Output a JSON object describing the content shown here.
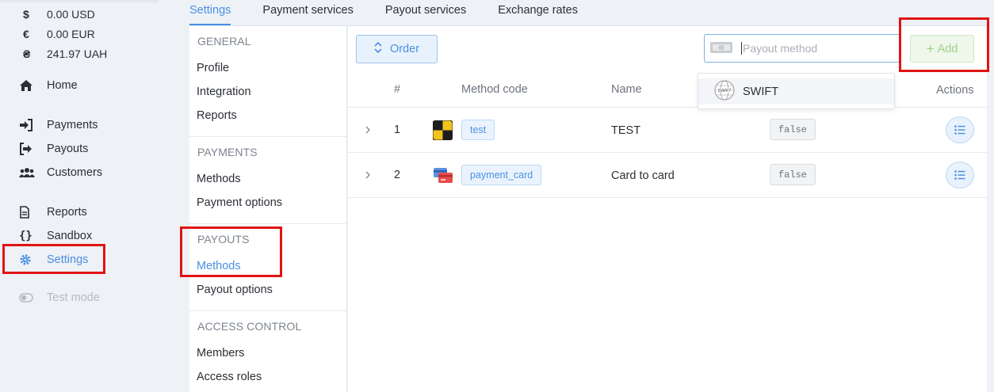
{
  "balances": [
    {
      "symbol": "$",
      "amount": "0.00 USD"
    },
    {
      "symbol": "€",
      "amount": "0.00 EUR"
    },
    {
      "symbol": "₴",
      "amount": "241.97 UAH"
    }
  ],
  "nav": {
    "home": "Home",
    "payments": "Payments",
    "payouts": "Payouts",
    "customers": "Customers",
    "reports": "Reports",
    "sandbox": "Sandbox",
    "settings": "Settings",
    "test_mode": "Test mode"
  },
  "tabs": [
    "Settings",
    "Payment services",
    "Payout services",
    "Exchange rates"
  ],
  "submenu": {
    "general": {
      "heading": "GENERAL",
      "items": [
        "Profile",
        "Integration",
        "Reports"
      ]
    },
    "payments": {
      "heading": "PAYMENTS",
      "items": [
        "Methods",
        "Payment options"
      ]
    },
    "payouts": {
      "heading": "PAYOUTS",
      "items": [
        "Methods",
        "Payout options"
      ]
    },
    "access": {
      "heading": "ACCESS CONTROL",
      "items": [
        "Members",
        "Access roles"
      ]
    }
  },
  "toolbar": {
    "order_label": "Order",
    "search_placeholder": "Payout method",
    "add_label": "Add"
  },
  "table": {
    "headers": {
      "index": "#",
      "method_code": "Method code",
      "name": "Name",
      "actions": "Actions"
    },
    "rows": [
      {
        "index": "1",
        "code": "test",
        "name": "TEST",
        "flag": "false"
      },
      {
        "index": "2",
        "code": "payment_card",
        "name": "Card to card",
        "flag": "false"
      }
    ]
  },
  "dropdown": {
    "items": [
      {
        "label": "SWIFT",
        "icon": "swift-icon"
      }
    ]
  },
  "colors": {
    "accent": "#4a90e2",
    "add_green": "#9dcf8c",
    "highlight": "#e11414"
  }
}
